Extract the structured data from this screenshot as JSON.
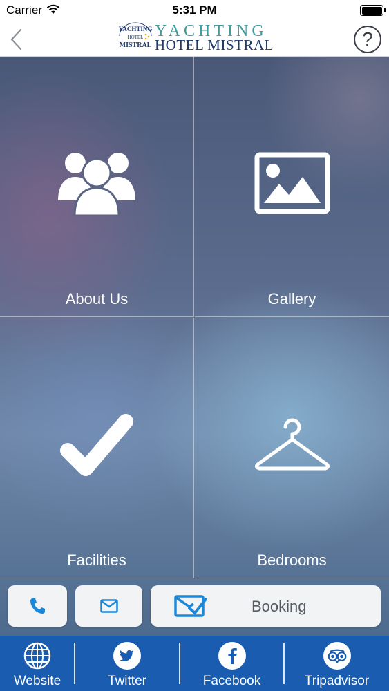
{
  "status_bar": {
    "carrier": "Carrier",
    "time": "5:31 PM"
  },
  "nav": {
    "logo_badge": {
      "top": "YACHTING",
      "middle": "HOTEL",
      "bottom": "MISTRAL"
    },
    "logo_line1": "YACHTING",
    "logo_line2": "HOTEL MISTRAL",
    "help_label": "?"
  },
  "tiles": [
    {
      "label": "About Us",
      "icon": "group-icon"
    },
    {
      "label": "Gallery",
      "icon": "image-icon"
    },
    {
      "label": "Facilities",
      "icon": "checkmark-icon"
    },
    {
      "label": "Bedrooms",
      "icon": "hanger-icon"
    }
  ],
  "actions": {
    "phone_icon": "phone-icon",
    "mail_icon": "mail-icon",
    "booking_label": "Booking",
    "booking_icon": "envelope-check-icon"
  },
  "bottom_bar": [
    {
      "label": "Website",
      "icon": "globe-icon"
    },
    {
      "label": "Twitter",
      "icon": "twitter-icon"
    },
    {
      "label": "Facebook",
      "icon": "facebook-icon"
    },
    {
      "label": "Tripadvisor",
      "icon": "tripadvisor-icon"
    }
  ],
  "colors": {
    "accent_blue": "#1a5db0",
    "action_icon_blue": "#1e88d8",
    "logo_teal": "#3f9a9a",
    "logo_navy": "#1f3a6e"
  }
}
